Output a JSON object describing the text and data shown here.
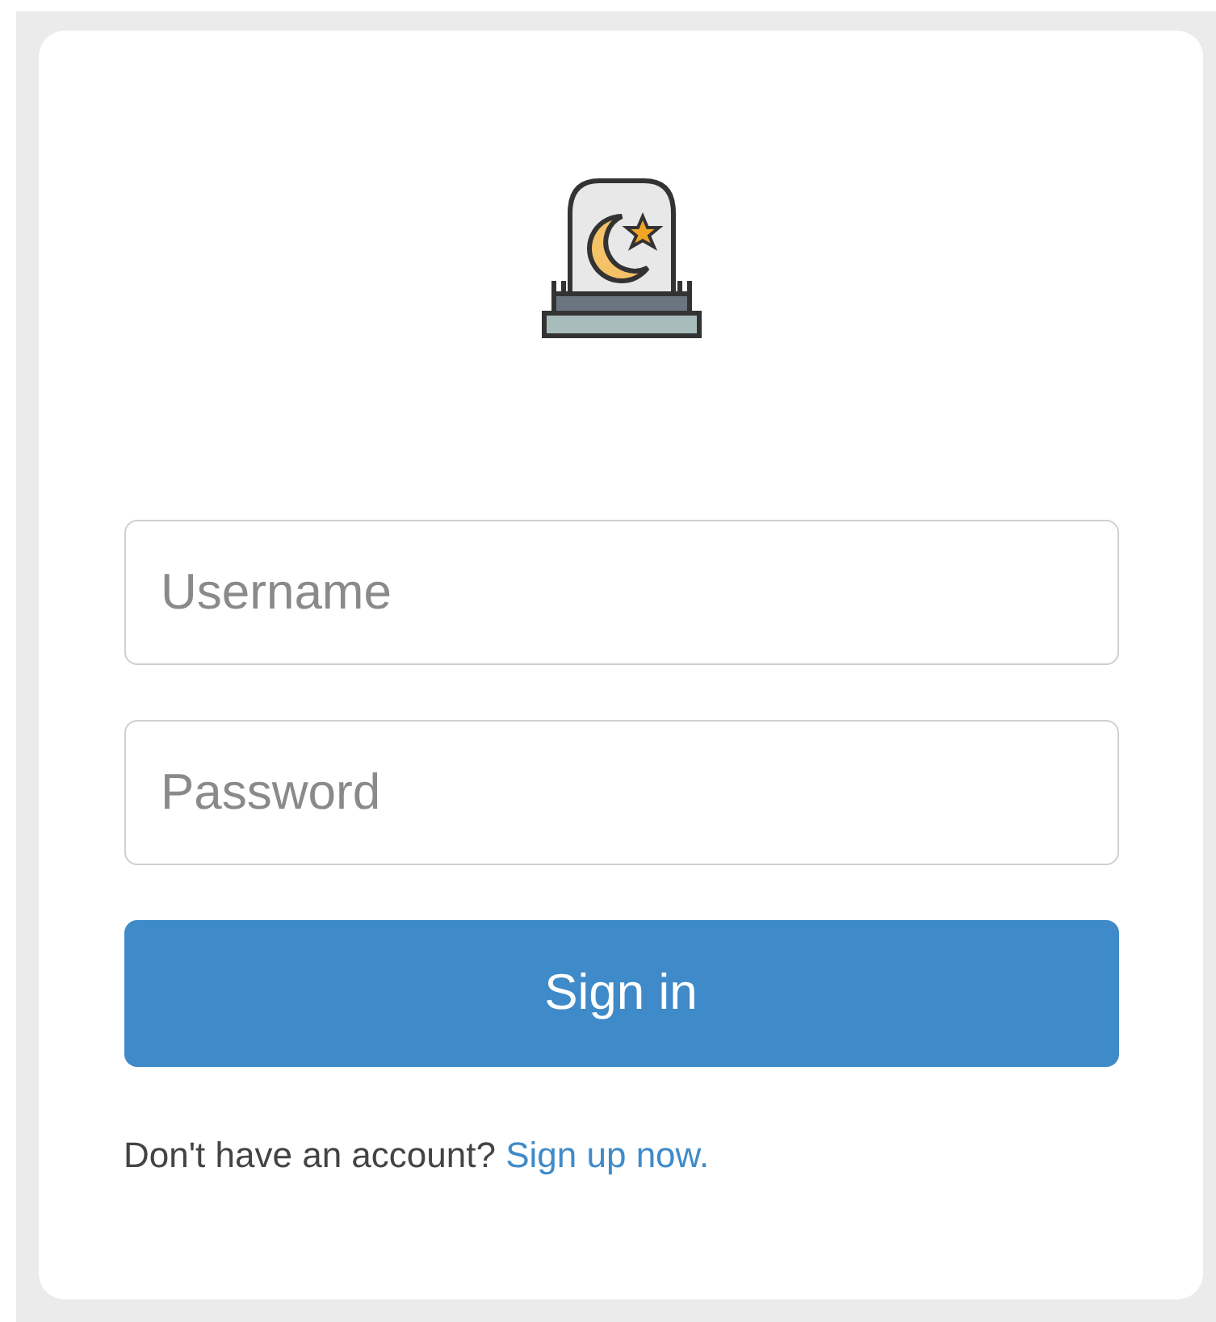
{
  "form": {
    "fields": [
      {
        "placeholder": "Username"
      },
      {
        "placeholder": "Password"
      }
    ],
    "submit": "Sign in",
    "footer": {
      "text": "Don't have an account?",
      "link": "Sign up now."
    }
  }
}
